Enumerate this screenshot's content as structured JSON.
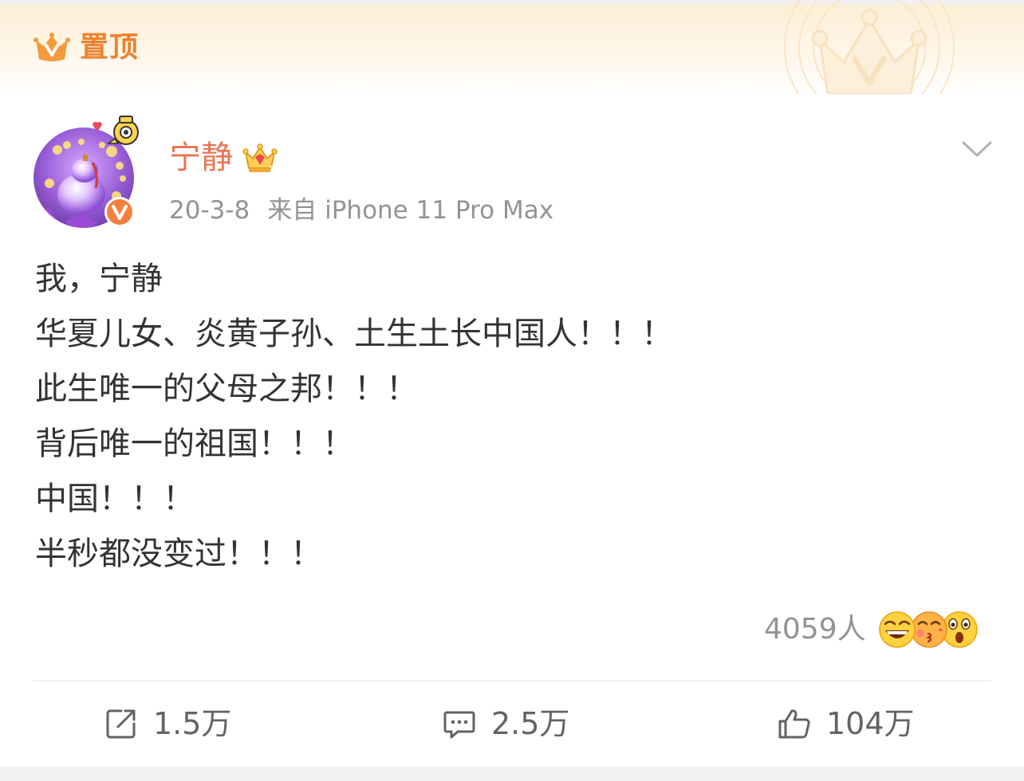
{
  "pinned": {
    "label": "置顶",
    "icon": "crown-v-icon"
  },
  "post": {
    "author": {
      "name": "宁静",
      "vip_icon": "vip-crown-icon",
      "verified_icon": "verified-v-badge-icon",
      "avatar_icon": "avatar-image"
    },
    "meta": {
      "date": "20-3-8",
      "source": "来自 iPhone 11 Pro Max"
    },
    "more_icon": "chevron-down-icon",
    "lines": [
      "我，宁静",
      "华夏儿女、炎黄子孙、土生土长中国人！！！",
      "此生唯一的父母之邦！！！",
      "背后唯一的祖国！！！",
      "中国！！！",
      "半秒都没变过！！！"
    ],
    "reactions": {
      "count": "4059人",
      "icons": [
        "laughing-face-icon",
        "kiss-face-icon",
        "surprised-face-icon"
      ]
    }
  },
  "actions": {
    "repost": {
      "count": "1.5万",
      "icon": "repost-icon"
    },
    "comment": {
      "count": "2.5万",
      "icon": "comment-icon"
    },
    "like": {
      "count": "104万",
      "icon": "thumbs-up-icon"
    }
  },
  "colors": {
    "accent_orange": "#eb7350",
    "pin_orange": "#f0812e",
    "meta_gray": "#939393",
    "text": "#333333",
    "action_gray": "#636363"
  }
}
